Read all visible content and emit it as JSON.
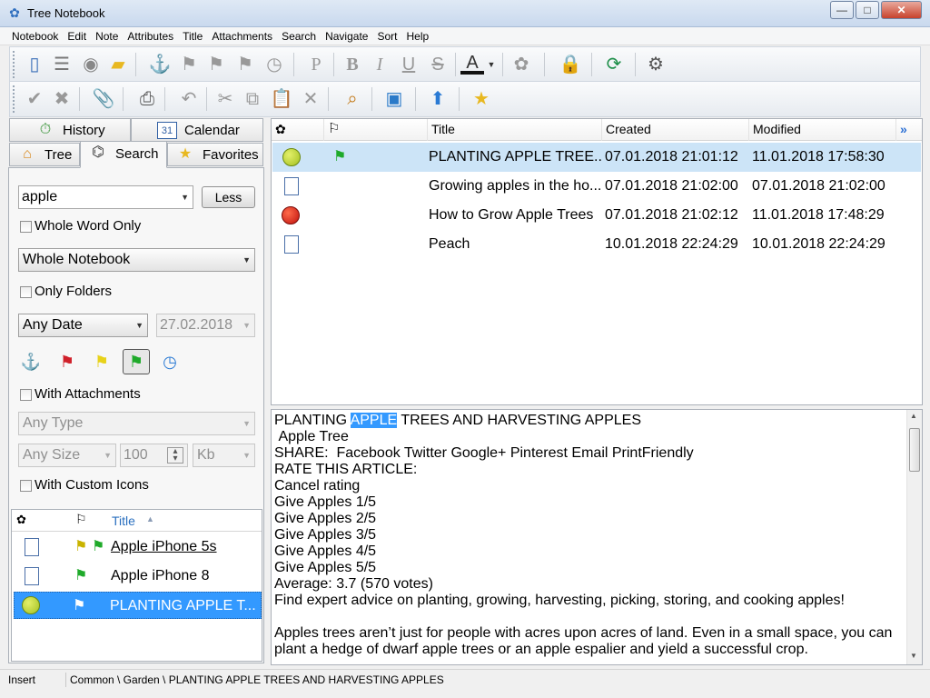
{
  "window": {
    "title": "Tree Notebook"
  },
  "menu": [
    "Notebook",
    "Edit",
    "Note",
    "Attributes",
    "Title",
    "Attachments",
    "Search",
    "Navigate",
    "Sort",
    "Help"
  ],
  "left_tabs": {
    "history": "History",
    "calendar": "Calendar",
    "tree": "Tree",
    "search": "Search",
    "favorites": "Favorites",
    "calendar_day": "31"
  },
  "search": {
    "query": "apple",
    "less_button": "Less",
    "whole_word_only": "Whole Word Only",
    "scope": "Whole Notebook",
    "only_folders": "Only Folders",
    "date_mode": "Any Date",
    "date_value": "27.02.2018",
    "with_attachments": "With Attachments",
    "type": "Any Type",
    "size_mode": "Any Size",
    "size_value": "100",
    "size_unit": "Kb",
    "with_custom_icons": "With Custom Icons"
  },
  "left_list": {
    "header_title": "Title",
    "rows": [
      {
        "title": "Apple iPhone 5s"
      },
      {
        "title": "Apple iPhone 8"
      },
      {
        "title": "PLANTING APPLE T..."
      }
    ]
  },
  "grid": {
    "headers": {
      "title": "Title",
      "created": "Created",
      "modified": "Modified"
    },
    "rows": [
      {
        "title": "PLANTING APPLE TREE...",
        "created": "07.01.2018 21:01:12",
        "modified": "11.01.2018 17:58:30"
      },
      {
        "title": "Growing apples in the ho...",
        "created": "07.01.2018 21:02:00",
        "modified": "07.01.2018 21:02:00"
      },
      {
        "title": "How to Grow Apple Trees",
        "created": "07.01.2018 21:02:12",
        "modified": "11.01.2018 17:48:29"
      },
      {
        "title": "Peach",
        "created": "10.01.2018 22:24:29",
        "modified": "10.01.2018 22:24:29"
      }
    ]
  },
  "content": {
    "line1_pre": "PLANTING ",
    "line1_hl": "APPLE",
    "line1_post": " TREES AND HARVESTING APPLES",
    "body": " Apple Tree\nSHARE:  Facebook Twitter Google+ Pinterest Email PrintFriendly\nRATE THIS ARTICLE:\nCancel rating\nGive Apples 1/5\nGive Apples 2/5\nGive Apples 3/5\nGive Apples 4/5\nGive Apples 5/5\nAverage: 3.7 (570 votes)\nFind expert advice on planting, growing, harvesting, picking, storing, and cooking apples!\n\nApples trees aren’t just for people with acres upon acres of land. Even in a small space, you can plant a hedge of dwarf apple trees or an apple espalier and yield a successful crop."
  },
  "status": {
    "mode": "Insert",
    "path": "Common \\ Garden \\ PLANTING APPLE TREES AND HARVESTING APPLES"
  },
  "colors": {
    "accent": "#3399ff",
    "selected_row": "#cce4f7"
  }
}
